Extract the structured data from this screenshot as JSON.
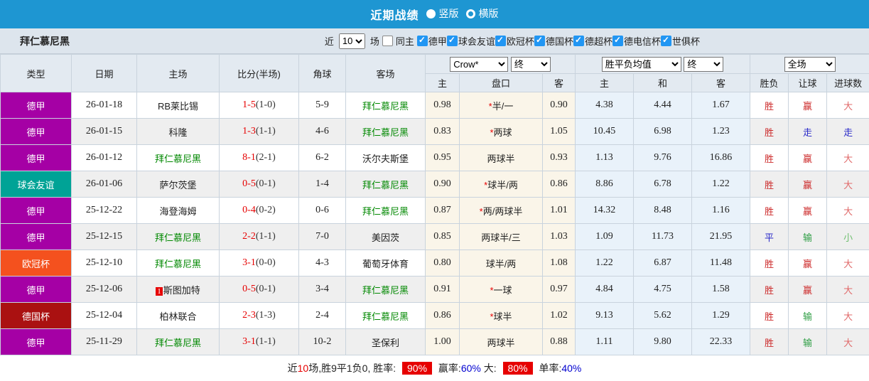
{
  "topbar": {
    "title": "近期战绩",
    "radios": [
      {
        "label": "竖版",
        "selected": true
      },
      {
        "label": "横版",
        "selected": false
      }
    ]
  },
  "filter": {
    "team": "拜仁慕尼黑",
    "near_label": "近",
    "match_count": "10",
    "unit_label": "场",
    "same_home": {
      "label": "同主",
      "checked": false
    },
    "leagues": [
      {
        "label": "德甲",
        "checked": true
      },
      {
        "label": "球会友谊",
        "checked": true
      },
      {
        "label": "欧冠杯",
        "checked": true
      },
      {
        "label": "德国杯",
        "checked": true
      },
      {
        "label": "德超杯",
        "checked": true
      },
      {
        "label": "德电信杯",
        "checked": true
      },
      {
        "label": "世俱杯",
        "checked": true
      }
    ]
  },
  "table": {
    "selects": {
      "bookmaker": "Crow*",
      "book_period": "终",
      "average": "胜平负均值",
      "avg_period": "终",
      "scope": "全场"
    },
    "columns": {
      "type": "类型",
      "date": "日期",
      "home": "主场",
      "score": "比分(半场)",
      "corner": "角球",
      "away": "客场",
      "pan_home": "主",
      "pan": "盘口",
      "pan_away": "客",
      "avg_home": "主",
      "avg_draw": "和",
      "avg_away": "客",
      "result_wdl": "胜负",
      "result_pan": "让球",
      "result_goal": "进球数"
    },
    "type_colors": {
      "德甲": "#a500a5",
      "球会友谊": "#00a396",
      "欧冠杯": "#f4511e",
      "德国杯": "#aa1111"
    },
    "rows": [
      {
        "type": "德甲",
        "date": "26-01-18",
        "home": "RB莱比锡",
        "home_green": false,
        "home_rank": "",
        "score": "1-5",
        "half": "(1-0)",
        "corner": "5-9",
        "away": "拜仁慕尼黑",
        "away_green": true,
        "pan_home": "0.98",
        "pan_star": true,
        "pan": "半/一",
        "pan_away": "0.90",
        "avg_home": "4.38",
        "avg_draw": "4.44",
        "avg_away": "1.67",
        "res_wdl": "胜",
        "res_wdl_color": "red",
        "res_pan": "赢",
        "res_pan_color": "red",
        "res_goal": "大",
        "res_goal_color": "lightred"
      },
      {
        "type": "德甲",
        "date": "26-01-15",
        "home": "科隆",
        "home_green": false,
        "home_rank": "",
        "score": "1-3",
        "half": "(1-1)",
        "corner": "4-6",
        "away": "拜仁慕尼黑",
        "away_green": true,
        "pan_home": "0.83",
        "pan_star": true,
        "pan": "两球",
        "pan_away": "1.05",
        "avg_home": "10.45",
        "avg_draw": "6.98",
        "avg_away": "1.23",
        "res_wdl": "胜",
        "res_wdl_color": "red",
        "res_pan": "走",
        "res_pan_color": "blue",
        "res_goal": "走",
        "res_goal_color": "blue"
      },
      {
        "type": "德甲",
        "date": "26-01-12",
        "home": "拜仁慕尼黑",
        "home_green": true,
        "home_rank": "",
        "score": "8-1",
        "half": "(2-1)",
        "corner": "6-2",
        "away": "沃尔夫斯堡",
        "away_green": false,
        "pan_home": "0.95",
        "pan_star": false,
        "pan": "两球半",
        "pan_away": "0.93",
        "avg_home": "1.13",
        "avg_draw": "9.76",
        "avg_away": "16.86",
        "res_wdl": "胜",
        "res_wdl_color": "red",
        "res_pan": "赢",
        "res_pan_color": "red",
        "res_goal": "大",
        "res_goal_color": "lightred"
      },
      {
        "type": "球会友谊",
        "date": "26-01-06",
        "home": "萨尔茨堡",
        "home_green": false,
        "home_rank": "",
        "score": "0-5",
        "half": "(0-1)",
        "corner": "1-4",
        "away": "拜仁慕尼黑",
        "away_green": true,
        "pan_home": "0.90",
        "pan_star": true,
        "pan": "球半/两",
        "pan_away": "0.86",
        "avg_home": "8.86",
        "avg_draw": "6.78",
        "avg_away": "1.22",
        "res_wdl": "胜",
        "res_wdl_color": "red",
        "res_pan": "赢",
        "res_pan_color": "red",
        "res_goal": "大",
        "res_goal_color": "lightred"
      },
      {
        "type": "德甲",
        "date": "25-12-22",
        "home": "海登海姆",
        "home_green": false,
        "home_rank": "",
        "score": "0-4",
        "half": "(0-2)",
        "corner": "0-6",
        "away": "拜仁慕尼黑",
        "away_green": true,
        "pan_home": "0.87",
        "pan_star": true,
        "pan": "两/两球半",
        "pan_away": "1.01",
        "avg_home": "14.32",
        "avg_draw": "8.48",
        "avg_away": "1.16",
        "res_wdl": "胜",
        "res_wdl_color": "red",
        "res_pan": "赢",
        "res_pan_color": "red",
        "res_goal": "大",
        "res_goal_color": "lightred"
      },
      {
        "type": "德甲",
        "date": "25-12-15",
        "home": "拜仁慕尼黑",
        "home_green": true,
        "home_rank": "",
        "score": "2-2",
        "half": "(1-1)",
        "corner": "7-0",
        "away": "美因茨",
        "away_green": false,
        "pan_home": "0.85",
        "pan_star": false,
        "pan": "两球半/三",
        "pan_away": "1.03",
        "avg_home": "1.09",
        "avg_draw": "11.73",
        "avg_away": "21.95",
        "res_wdl": "平",
        "res_wdl_color": "blue",
        "res_pan": "输",
        "res_pan_color": "green",
        "res_goal": "小",
        "res_goal_color": "lightgreen"
      },
      {
        "type": "欧冠杯",
        "date": "25-12-10",
        "home": "拜仁慕尼黑",
        "home_green": true,
        "home_rank": "",
        "score": "3-1",
        "half": "(0-0)",
        "corner": "4-3",
        "away": "葡萄牙体育",
        "away_green": false,
        "pan_home": "0.80",
        "pan_star": false,
        "pan": "球半/两",
        "pan_away": "1.08",
        "avg_home": "1.22",
        "avg_draw": "6.87",
        "avg_away": "11.48",
        "res_wdl": "胜",
        "res_wdl_color": "red",
        "res_pan": "赢",
        "res_pan_color": "red",
        "res_goal": "大",
        "res_goal_color": "lightred"
      },
      {
        "type": "德甲",
        "date": "25-12-06",
        "home": "斯图加特",
        "home_green": false,
        "home_rank": "1",
        "score": "0-5",
        "half": "(0-1)",
        "corner": "3-4",
        "away": "拜仁慕尼黑",
        "away_green": true,
        "pan_home": "0.91",
        "pan_star": true,
        "pan": "一球",
        "pan_away": "0.97",
        "avg_home": "4.84",
        "avg_draw": "4.75",
        "avg_away": "1.58",
        "res_wdl": "胜",
        "res_wdl_color": "red",
        "res_pan": "赢",
        "res_pan_color": "red",
        "res_goal": "大",
        "res_goal_color": "lightred"
      },
      {
        "type": "德国杯",
        "date": "25-12-04",
        "home": "柏林联合",
        "home_green": false,
        "home_rank": "",
        "score": "2-3",
        "half": "(1-3)",
        "corner": "2-4",
        "away": "拜仁慕尼黑",
        "away_green": true,
        "pan_home": "0.86",
        "pan_star": true,
        "pan": "球半",
        "pan_away": "1.02",
        "avg_home": "9.13",
        "avg_draw": "5.62",
        "avg_away": "1.29",
        "res_wdl": "胜",
        "res_wdl_color": "red",
        "res_pan": "输",
        "res_pan_color": "green",
        "res_goal": "大",
        "res_goal_color": "lightred"
      },
      {
        "type": "德甲",
        "date": "25-11-29",
        "home": "拜仁慕尼黑",
        "home_green": true,
        "home_rank": "",
        "score": "3-1",
        "half": "(1-1)",
        "corner": "10-2",
        "away": "圣保利",
        "away_green": false,
        "pan_home": "1.00",
        "pan_star": false,
        "pan": "两球半",
        "pan_away": "0.88",
        "avg_home": "1.11",
        "avg_draw": "9.80",
        "avg_away": "22.33",
        "res_wdl": "胜",
        "res_wdl_color": "red",
        "res_pan": "输",
        "res_pan_color": "green",
        "res_goal": "大",
        "res_goal_color": "lightred"
      }
    ]
  },
  "summary": {
    "segments": [
      {
        "text": "近",
        "style": "plain"
      },
      {
        "text": "10",
        "style": "red-text"
      },
      {
        "text": "场,胜9平1负0, 胜率: ",
        "style": "plain"
      },
      {
        "text": "90%",
        "style": "red-badge"
      },
      {
        "text": " 赢率:",
        "style": "plain"
      },
      {
        "text": "60%",
        "style": "blue-text"
      },
      {
        "text": " 大: ",
        "style": "plain"
      },
      {
        "text": "80%",
        "style": "red-badge"
      },
      {
        "text": " 单率:",
        "style": "plain"
      },
      {
        "text": "40%",
        "style": "blue-text"
      }
    ]
  }
}
